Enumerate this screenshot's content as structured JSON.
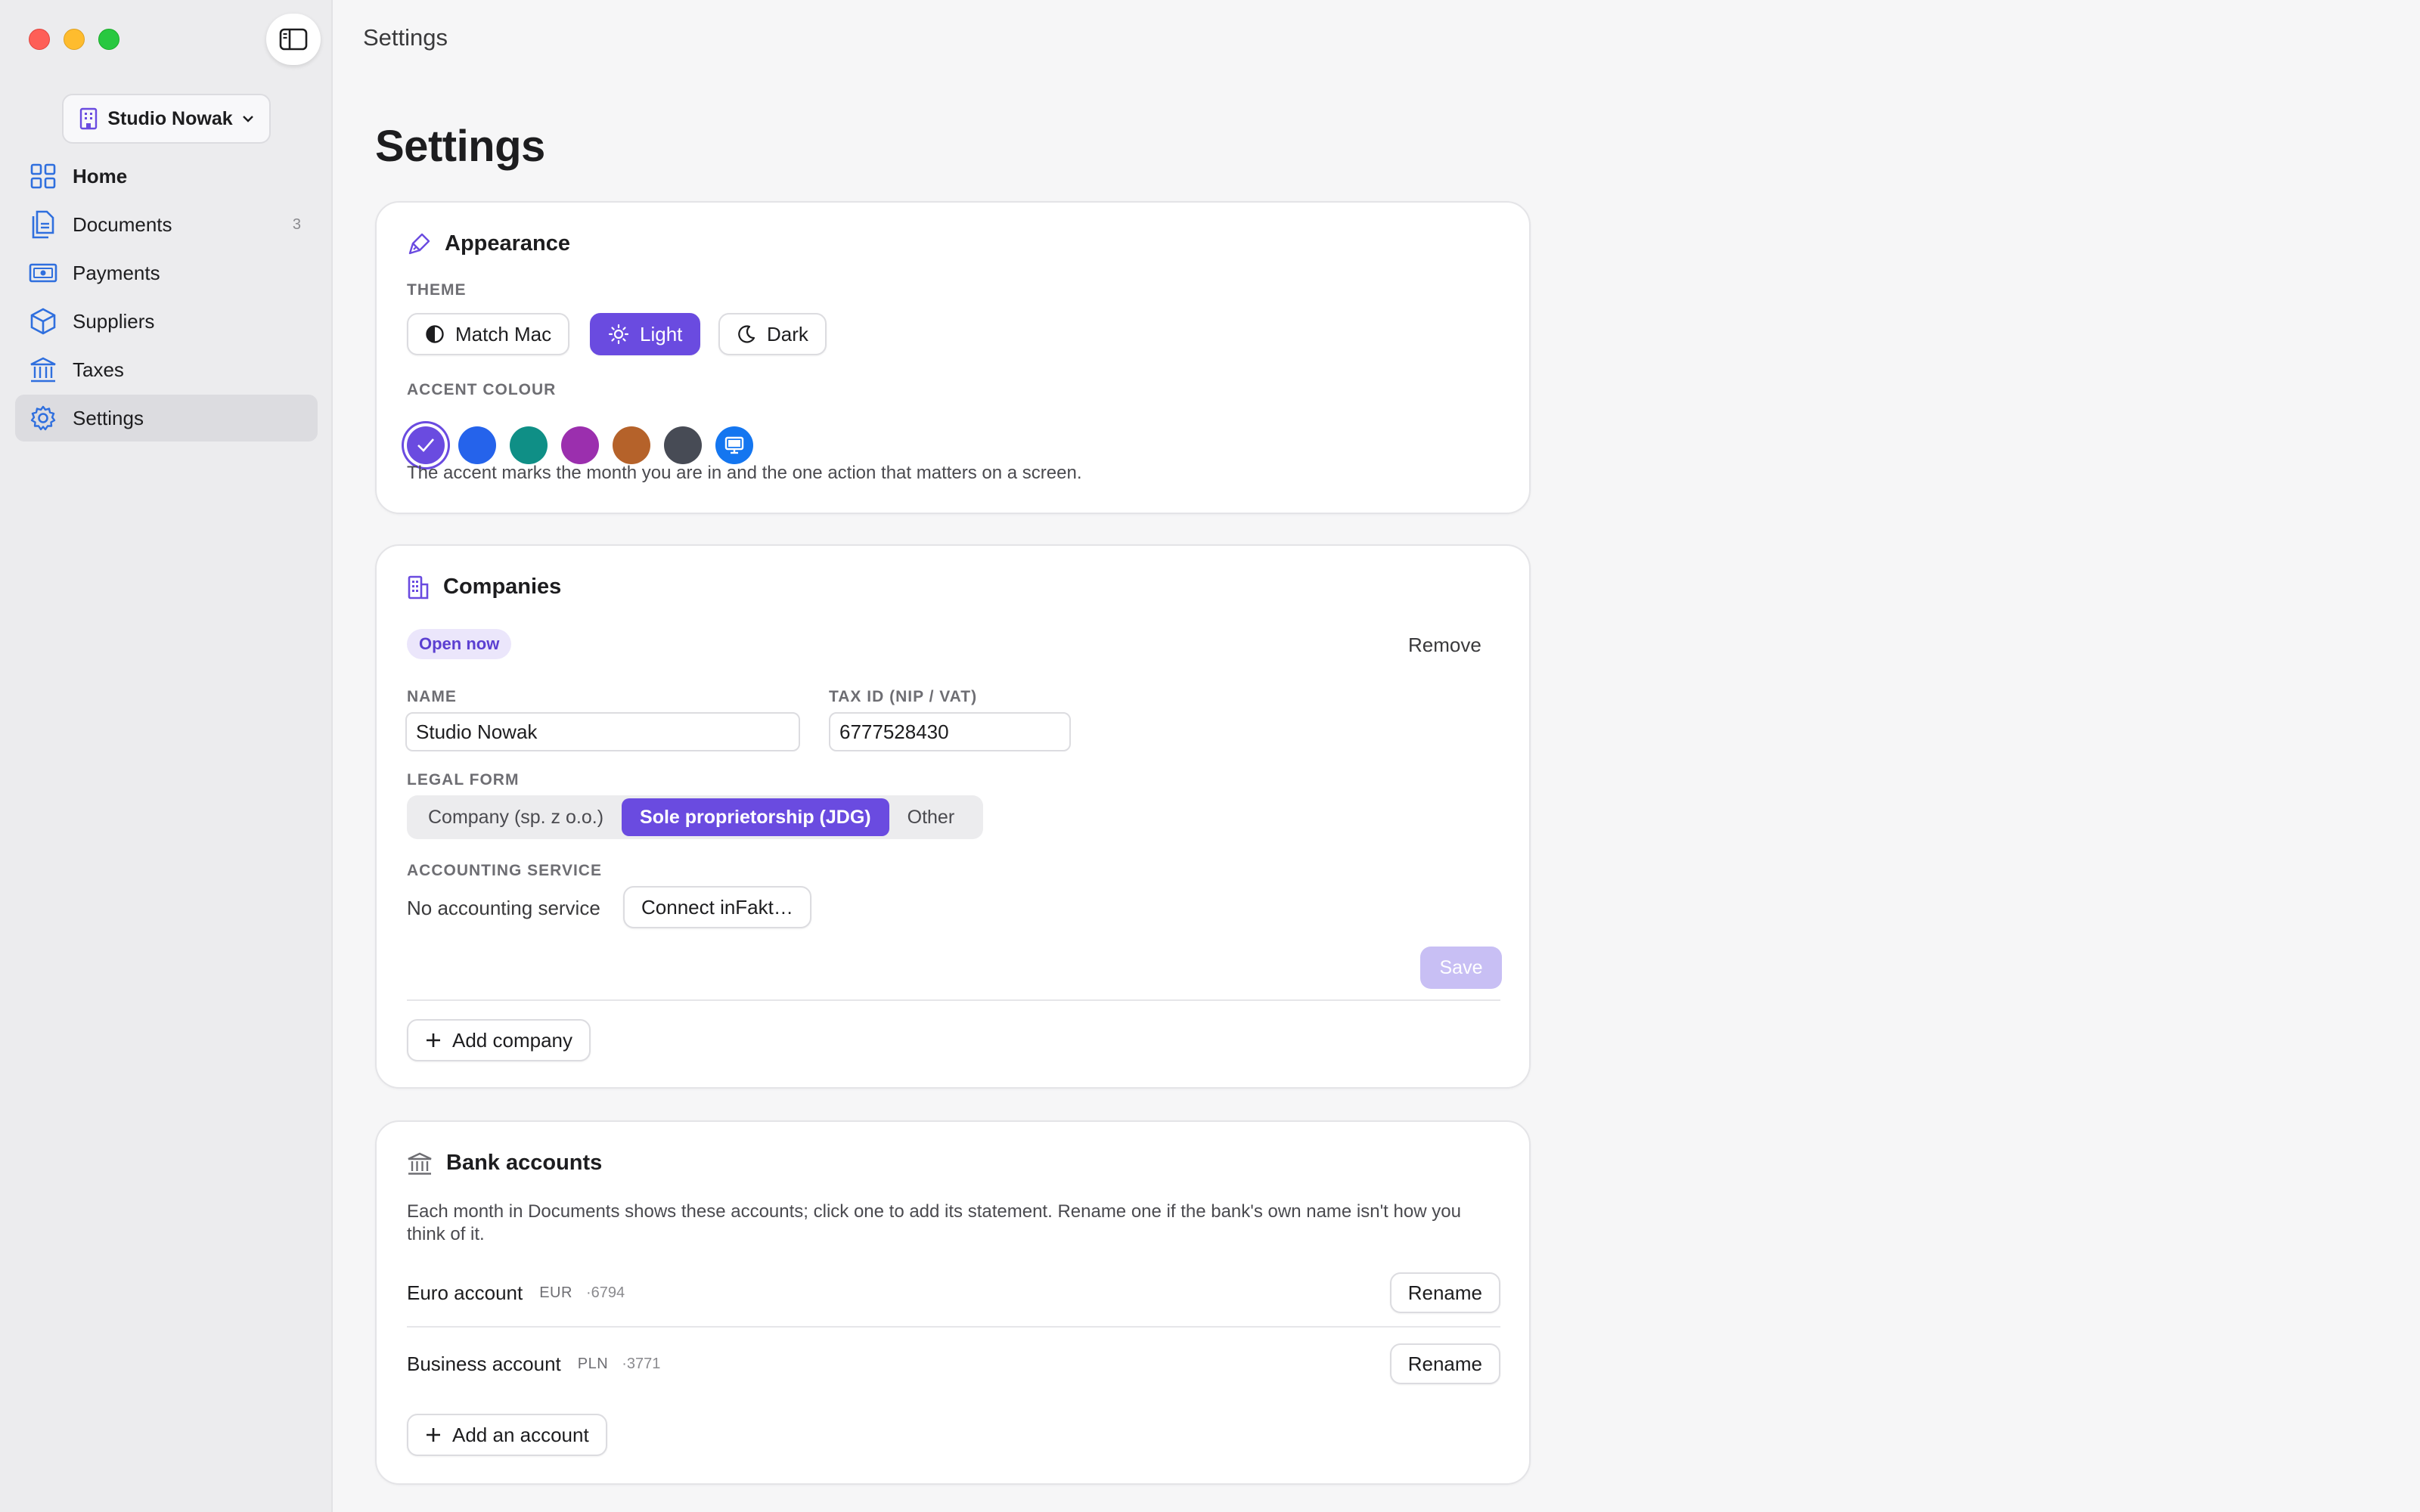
{
  "window": {
    "title": "Settings"
  },
  "sidebar": {
    "company_switcher": "Studio Nowak",
    "items": [
      {
        "label": "Home",
        "icon": "grid-icon",
        "count": ""
      },
      {
        "label": "Documents",
        "icon": "documents-icon",
        "count": "3"
      },
      {
        "label": "Payments",
        "icon": "banknote-icon",
        "count": ""
      },
      {
        "label": "Suppliers",
        "icon": "box-icon",
        "count": ""
      },
      {
        "label": "Taxes",
        "icon": "bank-icon",
        "count": ""
      },
      {
        "label": "Settings",
        "icon": "gear-icon",
        "count": ""
      }
    ],
    "active_item": "Settings"
  },
  "main": {
    "title": "Settings",
    "appearance": {
      "title": "Appearance",
      "theme_label": "THEME",
      "theme_options": [
        "Match Mac",
        "Light",
        "Dark"
      ],
      "theme_selected": "Light",
      "accent_label": "ACCENT COLOUR",
      "accent_colors": [
        "#6a4be0",
        "#2563eb",
        "#0f8f86",
        "#9b2fae",
        "#b5622a",
        "#474b55",
        "#1476f0"
      ],
      "accent_selected": 0,
      "accent_hint": "The accent marks the month you are in and the one action that matters on a screen."
    },
    "companies": {
      "title": "Companies",
      "badge": "Open now",
      "remove_label": "Remove",
      "name_label": "NAME",
      "name_value": "Studio Nowak",
      "taxid_label": "TAX ID (NIP / VAT)",
      "taxid_value": "6777528430",
      "legal_form_label": "LEGAL FORM",
      "legal_form_options": [
        "Company (sp. z o.o.)",
        "Sole proprietorship (JDG)",
        "Other"
      ],
      "legal_form_selected": "Sole proprietorship (JDG)",
      "accounting_label": "ACCOUNTING SERVICE",
      "accounting_value": "No accounting service",
      "connect_label": "Connect inFakt…",
      "save_label": "Save",
      "add_label": "Add company"
    },
    "bank_accounts": {
      "title": "Bank accounts",
      "description": "Each month in Documents shows these accounts; click one to add its statement. Rename one if the bank's own name isn't how you think of it.",
      "accounts": [
        {
          "name": "Euro account",
          "currency": "EUR",
          "number": "·6794",
          "action": "Rename"
        },
        {
          "name": "Business account",
          "currency": "PLN",
          "number": "·3771",
          "action": "Rename"
        }
      ],
      "add_label": "Add an account"
    }
  },
  "colors": {
    "accent": "#6a4be0"
  }
}
